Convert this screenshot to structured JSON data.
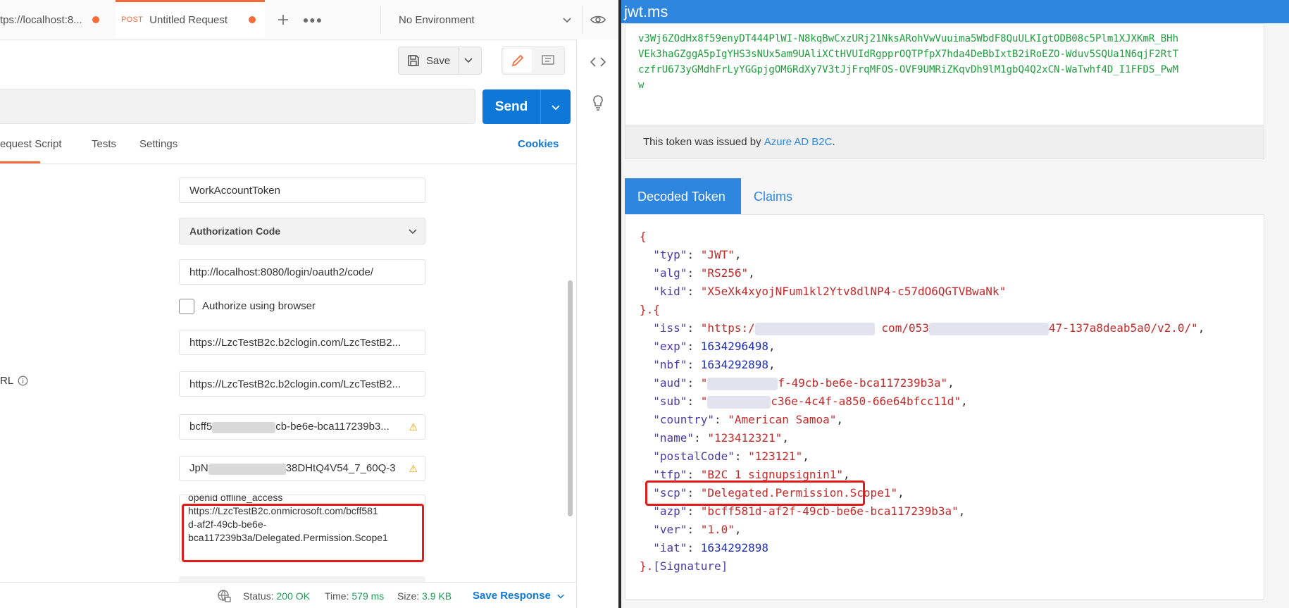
{
  "postman": {
    "tabs": [
      {
        "label": "tps://localhost:8...",
        "method": ""
      },
      {
        "label": "Untitled Request",
        "method": "POST"
      }
    ],
    "environment": "No Environment",
    "save_label": "Save",
    "send_label": "Send",
    "subtabs": [
      "equest Script",
      "Tests",
      "Settings"
    ],
    "cookies_label": "Cookies",
    "url_label_fragment": "RL",
    "fields": {
      "token_name": "WorkAccountToken",
      "grant_type": "Authorization Code",
      "callback_url": "http://localhost:8080/login/oauth2/code/",
      "authorize_browser_label": "Authorize using browser",
      "auth_url": "https://LzcTestB2c.b2clogin.com/LzcTestB2...",
      "access_token_url": "https://LzcTestB2c.b2clogin.com/LzcTestB2...",
      "client_id_prefix": "bcff5",
      "client_id_suffix": "cb-be6e-bca117239b3...",
      "client_secret_prefix": "JpN",
      "client_secret_suffix": "38DHtQ4V54_7_60Q-3",
      "scope_lines": [
        "openid offline_access",
        "https://LzcTestB2c.onmicrosoft.com/bcff581",
        "d-af2f-49cb-be6e-",
        "bca117239b3a/Delegated.Permission.Scope1"
      ]
    },
    "status": {
      "label": "Status:",
      "value": "200 OK",
      "time_label": "Time:",
      "time_value": "579 ms",
      "size_label": "Size:",
      "size_value": "3.9 KB",
      "save_response": "Save Response"
    }
  },
  "jwt": {
    "site_title": "jwt.ms",
    "encoded_lines": [
      "v3Wj6ZOdHx8f59enyDT444PlWI-N8kqBwCxzURj21NksARohVwVuuima5WbdF8QuULKIgtODB08c5Plm1XJXKmR_BHh",
      "VEk3haGZggA5pIgYHS3sNUx5am9UAliXCtHVUIdRgpprOQTPfpX7hda4DeBbIxtB2iRoEZO-Wduv5SQUa1N6qjF2RtT",
      "czfrU673yGMdhFrLyYGGpjgOM6RdXy7V3tJjFrqMFOS-OVF9UMRiZKqvDh9lM1gbQ4Q2xCN-WaTwhf4D_I1FFDS_PwM",
      "w"
    ],
    "issued_prefix": "This token was issued by",
    "issued_link": "Azure AD B2C",
    "issued_suffix": ".",
    "tab_decoded": "Decoded Token",
    "tab_claims": "Claims",
    "header": {
      "typ": "JWT",
      "alg": "RS256",
      "kid": "X5eXk4xyojNFum1kl2Ytv8dlNP4-c57dO6QGTVBwaNk"
    },
    "claims": {
      "iss_prefix": "https:/",
      "iss_mid": "com/053",
      "iss_suffix": "47-137a8deab5a0/v2.0/",
      "exp": "1634296498",
      "nbf": "1634292898",
      "aud_suffix": "f-49cb-be6e-bca117239b3a",
      "sub_suffix": "c36e-4c4f-a850-66e64bfcc11d",
      "country": "American Samoa",
      "name": "123412321",
      "postalCode": "123121",
      "tfp": "B2C_1_signupsignin1",
      "scp": "Delegated.Permission.Scope1",
      "azp": "bcff581d-af2f-49cb-be6e-bca117239b3a",
      "ver": "1.0",
      "iat": "1634292898"
    },
    "signature_label": "[Signature]"
  },
  "colors": {
    "postman_accent": "#f26b3a",
    "send_blue": "#0e78d8",
    "jwt_blue": "#2f86de",
    "highlight_red": "#e01c1c",
    "token_green": "#1c9e3a"
  }
}
